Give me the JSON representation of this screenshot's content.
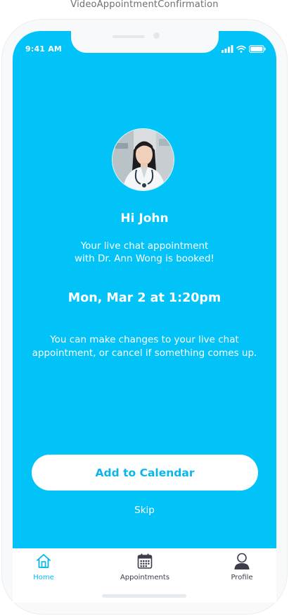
{
  "artboard": {
    "title": "VideoAppointmentConfirmation"
  },
  "status_bar": {
    "time": "9:41 AM",
    "icons": [
      "signal-icon",
      "wifi-icon",
      "battery-icon"
    ]
  },
  "confirmation": {
    "greeting": "Hi John",
    "message_line1": "Your live chat appointment",
    "message_line2": "with Dr. Ann Wong is booked!",
    "appointment_time": "Mon, Mar 2 at 1:20pm",
    "note_line1": "You can make changes to your live chat",
    "note_line2": "appointment, or cancel if something comes up."
  },
  "actions": {
    "add_to_calendar_label": "Add to Calendar",
    "skip_label": "Skip"
  },
  "tabbar": {
    "tabs": [
      {
        "label": "Home",
        "icon": "home-icon",
        "active": true
      },
      {
        "label": "Appointments",
        "icon": "calendar-icon",
        "active": false
      },
      {
        "label": "Profile",
        "icon": "profile-icon",
        "active": false
      }
    ]
  },
  "colors": {
    "background": "#01c3f8",
    "accent": "#03b7ee",
    "button_text": "#0bb6ec",
    "tab_inactive": "#3d3d4d"
  }
}
